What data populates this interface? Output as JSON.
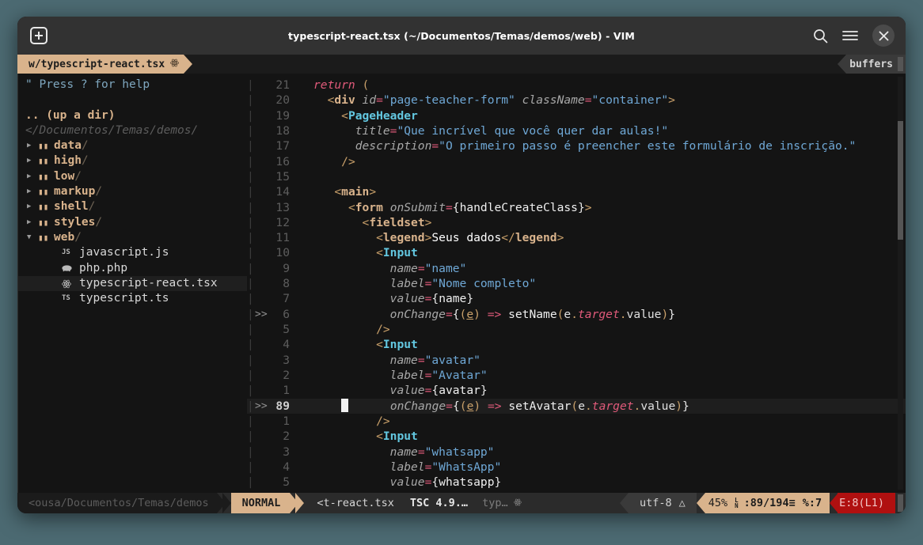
{
  "window": {
    "title": "typescript-react.tsx (~/Documentos/Temas/demos/web) - VIM",
    "new_tab_label": "+",
    "search_icon": "search-icon",
    "menu_icon": "hamburger-menu-icon",
    "close_icon": "close-icon"
  },
  "tabline": {
    "active_tab": "w/typescript-react.tsx",
    "active_tab_icon": "react-atom-icon",
    "buffers_label": "buffers"
  },
  "sidebar": {
    "help_line": "\" Press ? for help",
    "up_a_dir": ".. (up a dir)",
    "cwd": "</Documentos/Temas/demos/",
    "directories": [
      {
        "name": "data",
        "expanded": false
      },
      {
        "name": "high",
        "expanded": false
      },
      {
        "name": "low",
        "expanded": false
      },
      {
        "name": "markup",
        "expanded": false
      },
      {
        "name": "shell",
        "expanded": false
      },
      {
        "name": "styles",
        "expanded": false
      },
      {
        "name": "web",
        "expanded": true
      }
    ],
    "files": [
      {
        "name": "javascript.js",
        "icon": "JS",
        "selected": false
      },
      {
        "name": "php.php",
        "icon": "php",
        "selected": false
      },
      {
        "name": "typescript-react.tsx",
        "icon": "react",
        "selected": true
      },
      {
        "name": "typescript.ts",
        "icon": "TS",
        "selected": false
      }
    ]
  },
  "editor": {
    "cursor_line_number": "89",
    "lines": [
      {
        "num": "21",
        "mark": "",
        "cursor": false
      },
      {
        "num": "20",
        "mark": "",
        "cursor": false
      },
      {
        "num": "19",
        "mark": "",
        "cursor": false
      },
      {
        "num": "18",
        "mark": "",
        "cursor": false
      },
      {
        "num": "17",
        "mark": "",
        "cursor": false
      },
      {
        "num": "16",
        "mark": "",
        "cursor": false
      },
      {
        "num": "15",
        "mark": "",
        "cursor": false
      },
      {
        "num": "14",
        "mark": "",
        "cursor": false
      },
      {
        "num": "13",
        "mark": "",
        "cursor": false
      },
      {
        "num": "12",
        "mark": "",
        "cursor": false
      },
      {
        "num": "11",
        "mark": "",
        "cursor": false
      },
      {
        "num": "10",
        "mark": "",
        "cursor": false
      },
      {
        "num": "9",
        "mark": "",
        "cursor": false
      },
      {
        "num": "8",
        "mark": "",
        "cursor": false
      },
      {
        "num": "7",
        "mark": "",
        "cursor": false
      },
      {
        "num": "6",
        "mark": ">>",
        "cursor": false
      },
      {
        "num": "5",
        "mark": "",
        "cursor": false
      },
      {
        "num": "4",
        "mark": "",
        "cursor": false
      },
      {
        "num": "3",
        "mark": "",
        "cursor": false
      },
      {
        "num": "2",
        "mark": "",
        "cursor": false
      },
      {
        "num": "1",
        "mark": "",
        "cursor": false
      },
      {
        "num": "89",
        "mark": ">>",
        "cursor": true
      },
      {
        "num": "1",
        "mark": "",
        "cursor": false
      },
      {
        "num": "2",
        "mark": "",
        "cursor": false
      },
      {
        "num": "3",
        "mark": "",
        "cursor": false
      },
      {
        "num": "4",
        "mark": "",
        "cursor": false
      },
      {
        "num": "5",
        "mark": "",
        "cursor": false
      }
    ],
    "code_text": [
      "return (",
      "<div id=\"page-teacher-form\" className=\"container\">",
      "<PageHeader",
      "title=\"Que incrível que você quer dar aulas!\"",
      "description=\"O primeiro passo é preencher este formulário de inscrição.\"",
      "/>",
      "",
      "<main>",
      "<form onSubmit={handleCreateClass}>",
      "<fieldset>",
      "<legend>Seus dados</legend>",
      "<Input",
      "name=\"name\"",
      "label=\"Nome completo\"",
      "value={name}",
      "onChange={(e) => setName(e.target.value)}",
      "/>",
      "<Input",
      "name=\"avatar\"",
      "label=\"Avatar\"",
      "value={avatar}",
      "onChange={(e) => setAvatar(e.target.value)}",
      "/>",
      "<Input",
      "name=\"whatsapp\"",
      "label=\"WhatsApp\"",
      "value={whatsapp}"
    ]
  },
  "statusline": {
    "path": "<ousa/Documentos/Temas/demos",
    "mode": "NORMAL",
    "filename": "<t-react.tsx",
    "tsc_version": "TSC 4.9.…",
    "linter": "typ…",
    "linter_icon": "react-atom-icon",
    "encoding": "utf-8",
    "encoding_icon": "△",
    "percent": "45%",
    "line_glyph_top": "L",
    "line_glyph_bottom": "N",
    "position": ":89/194≡",
    "column": "%:7",
    "errors": "E:8(L1)"
  },
  "colors": {
    "accent": "#d9b38c",
    "error": "#b01010",
    "background": "#141414",
    "desktop": "#4c6a72",
    "titlebar": "#323232"
  }
}
